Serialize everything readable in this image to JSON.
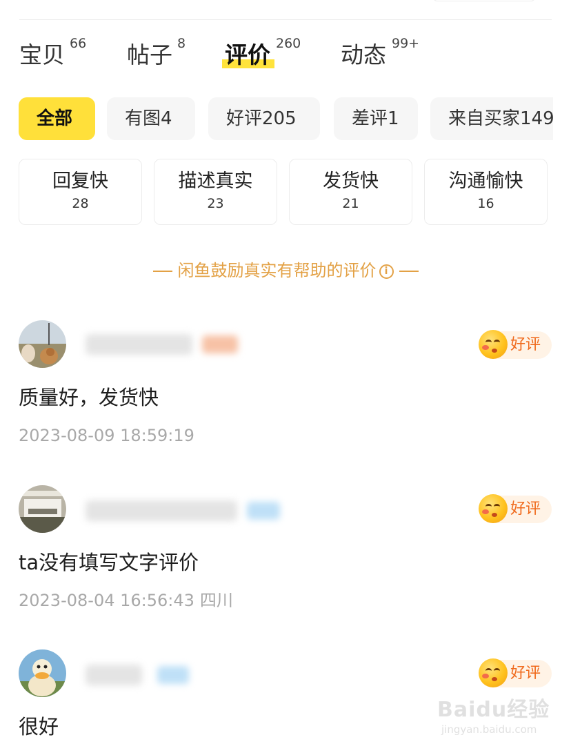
{
  "tabs": [
    {
      "label": "宝贝",
      "count": "66",
      "active": false
    },
    {
      "label": "帖子",
      "count": "8",
      "active": false
    },
    {
      "label": "评价",
      "count": "260",
      "active": true
    },
    {
      "label": "动态",
      "count": "99+",
      "active": false
    }
  ],
  "filters": [
    {
      "label": "全部",
      "active": true
    },
    {
      "label": "有图4",
      "active": false
    },
    {
      "label": "好评205",
      "active": false
    },
    {
      "label": "差评1",
      "active": false
    },
    {
      "label": "来自买家149",
      "active": false
    }
  ],
  "tag_cards": [
    {
      "name": "回复快",
      "count": "28"
    },
    {
      "name": "描述真实",
      "count": "23"
    },
    {
      "name": "发货快",
      "count": "21"
    },
    {
      "name": "沟通愉快",
      "count": "16"
    }
  ],
  "notice": {
    "text": "闲鱼鼓励真实有帮助的评价",
    "info_icon": "info-circle-icon"
  },
  "reviews": [
    {
      "avatar": "avatar-cat-photo",
      "badge": "好评",
      "text": "质量好，发货快",
      "time": "2023-08-09 18:59:19",
      "location": ""
    },
    {
      "avatar": "avatar-landscape-photo",
      "badge": "好评",
      "text": "ta没有填写文字评价",
      "time": "2023-08-04 16:56:43",
      "location": "四川"
    },
    {
      "avatar": "avatar-duck-photo",
      "badge": "好评",
      "text": "很好",
      "time": "",
      "location": ""
    }
  ],
  "watermark": {
    "text": "Baidu经验",
    "sub": "jingyan.baidu.com"
  },
  "colors": {
    "accent_yellow": "#ffe03a",
    "notice_orange": "#e3a145",
    "good_badge_orange": "#f06a1c",
    "meta_gray": "#a8a8a8"
  }
}
